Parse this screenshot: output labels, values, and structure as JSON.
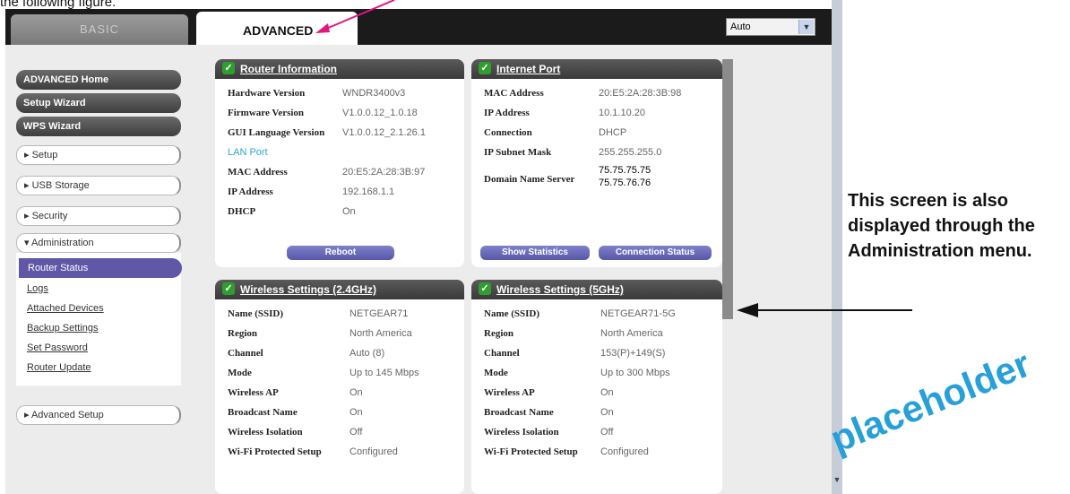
{
  "caption_top": "the following figure.",
  "topbar": {
    "tab_basic": "BASIC",
    "tab_advanced": "ADVANCED",
    "language_select": "Auto"
  },
  "sidebar": {
    "dark_items": [
      "ADVANCED Home",
      "Setup Wizard",
      "WPS Wizard"
    ],
    "light_items": [
      "▸ Setup",
      "▸ USB Storage",
      "▸ Security",
      "▾ Administration"
    ],
    "admin_sub": {
      "active": "Router Status",
      "links": [
        "Logs",
        "Attached Devices",
        "Backup Settings",
        "Set Password",
        "Router Update"
      ]
    },
    "advanced_setup": "▸ Advanced Setup"
  },
  "router_info": {
    "title": "Router Information",
    "rows": [
      {
        "label": "Hardware Version",
        "value": "WNDR3400v3"
      },
      {
        "label": "Firmware Version",
        "value": "V1.0.0.12_1.0.18"
      },
      {
        "label": "GUI Language Version",
        "value": "V1.0.0.12_2.1.26.1"
      }
    ],
    "lan_port": "LAN Port",
    "lan_rows": [
      {
        "label": "MAC Address",
        "value": "20:E5:2A:28:3B:97"
      },
      {
        "label": "IP Address",
        "value": "192.168.1.1"
      },
      {
        "label": "DHCP",
        "value": "On"
      }
    ],
    "reboot_button": "Reboot"
  },
  "internet_port": {
    "title": "Internet Port",
    "rows": [
      {
        "label": "MAC Address",
        "value": "20:E5:2A:28:3B:98"
      },
      {
        "label": "IP Address",
        "value": "10.1.10.20"
      },
      {
        "label": "Connection",
        "value": "DHCP"
      },
      {
        "label": "IP Subnet Mask",
        "value": "255.255.255.0"
      }
    ],
    "dns_label": "Domain Name Server",
    "dns_values": [
      "75.75.75.75",
      "75.75.76.76"
    ],
    "show_statistics": "Show Statistics",
    "connection_status": "Connection Status"
  },
  "wireless_24": {
    "title": "Wireless Settings (2.4GHz)",
    "rows": [
      {
        "label": "Name (SSID)",
        "value": "NETGEAR71"
      },
      {
        "label": "Region",
        "value": "North America"
      },
      {
        "label": "Channel",
        "value": "Auto (8)"
      },
      {
        "label": "Mode",
        "value": "Up to 145 Mbps"
      },
      {
        "label": "Wireless AP",
        "value": "On"
      },
      {
        "label": "Broadcast Name",
        "value": "On"
      },
      {
        "label": "Wireless Isolation",
        "value": "Off"
      },
      {
        "label": "Wi-Fi Protected Setup",
        "value": "Configured"
      }
    ]
  },
  "wireless_5": {
    "title": "Wireless Settings (5GHz)",
    "rows": [
      {
        "label": "Name (SSID)",
        "value": "NETGEAR71-5G"
      },
      {
        "label": "Region",
        "value": "North America"
      },
      {
        "label": "Channel",
        "value": "153(P)+149(S)"
      },
      {
        "label": "Mode",
        "value": "Up to 300 Mbps"
      },
      {
        "label": "Wireless AP",
        "value": "On"
      },
      {
        "label": "Broadcast Name",
        "value": "On"
      },
      {
        "label": "Wireless Isolation",
        "value": "Off"
      },
      {
        "label": "Wi-Fi Protected Setup",
        "value": "Configured"
      }
    ]
  },
  "annotation": {
    "note": "This screen is also displayed through the Administration menu.",
    "watermark": "placeholder",
    "arrow_color": "#e0157f"
  },
  "icons": [
    "check-icon",
    "dropdown-arrow-icon",
    "arrow-icon"
  ]
}
